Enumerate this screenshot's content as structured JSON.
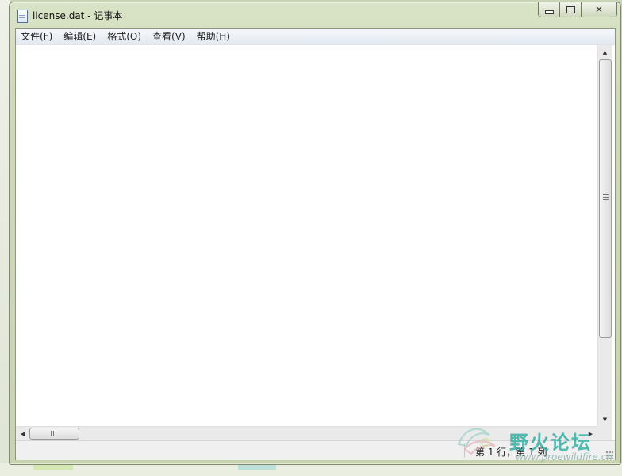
{
  "window": {
    "title": "license.dat - 记事本",
    "controls": {
      "minimize": "minimize-icon",
      "maximize": "maximize-icon",
      "close": "✕"
    }
  },
  "menubar": {
    "items": [
      {
        "label": "文件(F)"
      },
      {
        "label": "编辑(E)"
      },
      {
        "label": "格式(O)"
      },
      {
        "label": "查看(V)"
      },
      {
        "label": "帮助(H)"
      }
    ]
  },
  "editor": {
    "content": ""
  },
  "scrollbars": {
    "arrow_up": "▲",
    "arrow_down": "▼",
    "arrow_left": "◀",
    "arrow_right": "▶"
  },
  "statusbar": {
    "position": "第 1 行，第 1 列"
  },
  "watermark": {
    "title": "野火论坛",
    "url": "www.proewildfire.cn"
  }
}
